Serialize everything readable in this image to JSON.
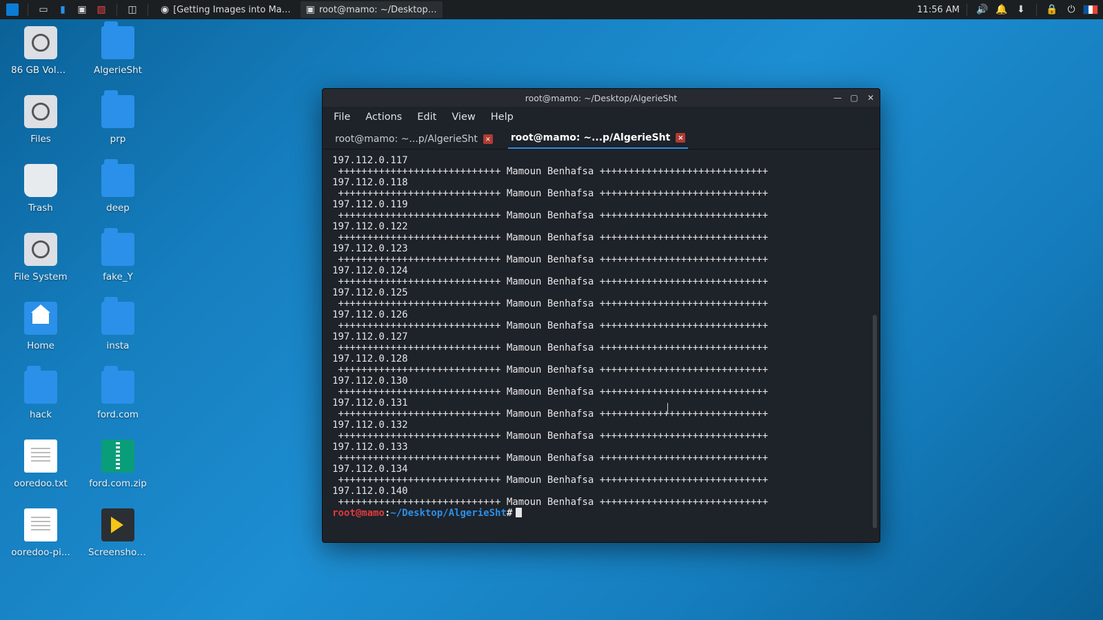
{
  "panel": {
    "clock": "11:56 AM",
    "tasks": [
      {
        "label": "[Getting Images into Ma…",
        "icon": "chrome"
      },
      {
        "label": "root@mamo: ~/Desktop…",
        "icon": "terminal",
        "active": true
      }
    ]
  },
  "desktop": {
    "col1": [
      {
        "label": "86 GB Volu...",
        "type": "drive"
      },
      {
        "label": "Files",
        "type": "drive"
      },
      {
        "label": "Trash",
        "type": "trash"
      },
      {
        "label": "File System",
        "type": "drive"
      },
      {
        "label": "Home",
        "type": "home"
      },
      {
        "label": "hack",
        "type": "folder"
      },
      {
        "label": "ooredoo.txt",
        "type": "text"
      },
      {
        "label": "ooredoo-pi...",
        "type": "text"
      }
    ],
    "col2": [
      {
        "label": "AlgerieSht",
        "type": "folder"
      },
      {
        "label": "prp",
        "type": "folder"
      },
      {
        "label": "deep",
        "type": "folder"
      },
      {
        "label": "fake_Y",
        "type": "folder"
      },
      {
        "label": "insta",
        "type": "folder"
      },
      {
        "label": "ford.com",
        "type": "folder"
      },
      {
        "label": "ford.com.zip",
        "type": "zip"
      },
      {
        "label": "Screenshot...",
        "type": "play"
      }
    ]
  },
  "terminal": {
    "title": "root@mamo: ~/Desktop/AlgerieSht",
    "menu": [
      "File",
      "Actions",
      "Edit",
      "View",
      "Help"
    ],
    "tabs": [
      {
        "label": "root@mamo: ~...p/AlgerieSht",
        "active": false
      },
      {
        "label": "root@mamo: ~...p/AlgerieSht",
        "active": true
      }
    ],
    "banner_line": " ++++++++++++++++++++++++++++ Mamoun Benhafsa +++++++++++++++++++++++++++++",
    "ips": [
      "197.112.0.117",
      "197.112.0.118",
      "197.112.0.119",
      "197.112.0.122",
      "197.112.0.123",
      "197.112.0.124",
      "197.112.0.125",
      "197.112.0.126",
      "197.112.0.127",
      "197.112.0.128",
      "197.112.0.130",
      "197.112.0.131",
      "197.112.0.132",
      "197.112.0.133",
      "197.112.0.134",
      "197.112.0.140"
    ],
    "prompt": {
      "user": "root@mamo",
      "sep": ":",
      "path": "~/Desktop/AlgerieSht",
      "hash": "#"
    }
  }
}
